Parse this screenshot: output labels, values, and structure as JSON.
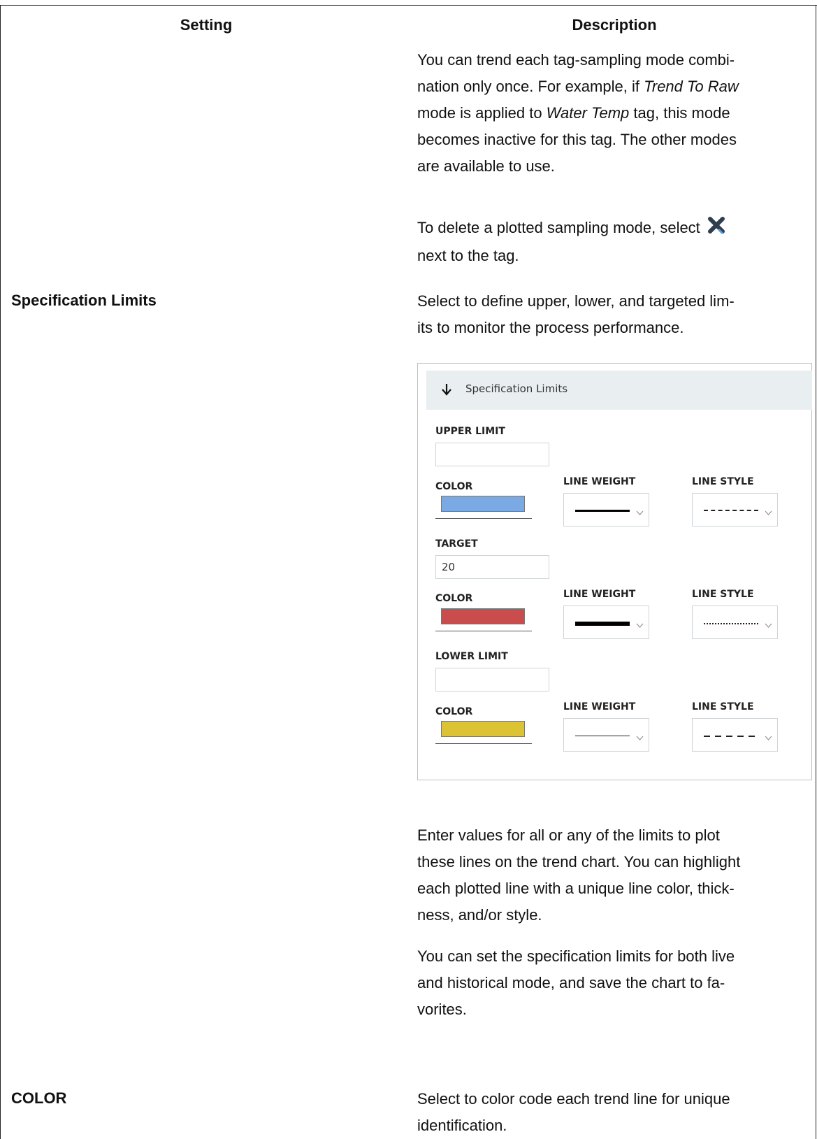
{
  "table": {
    "header_setting": "Setting",
    "header_description": "Description"
  },
  "row1": {
    "p1": {
      "t1": "You can trend each tag-sampling mode combi-",
      "t2": "nation only once. For example, if ",
      "t2_em": "Trend To Raw",
      "t3_em": "",
      "t3": "mode is applied to ",
      "t3_em2": "Water Temp",
      "t3_rest": " tag, this mode",
      "t4": "becomes inactive for this tag. The other modes",
      "t5": "are available to use."
    },
    "p2": {
      "t1": "To delete a plotted sampling mode, select",
      "t2": "next to the tag."
    }
  },
  "row2": {
    "setting": "Specification Limits",
    "intro_l1": "Select to define upper, lower, and targeted lim-",
    "intro_l2": "its to monitor the process performance.",
    "panel": {
      "title": "Specification Limits",
      "upper_label": "UPPER LIMIT",
      "upper_value": "",
      "target_label": "TARGET",
      "target_value": "20",
      "lower_label": "LOWER LIMIT",
      "lower_value": "",
      "color_label": "COLOR",
      "weight_label": "LINE WEIGHT",
      "style_label": "LINE STYLE",
      "colors": {
        "upper": "#7aa9e3",
        "target": "#c94d4d",
        "lower": "#dcc333"
      }
    },
    "p_after_1": {
      "l1": "Enter values for all or any of the limits to plot",
      "l2": "these lines on the trend chart. You can highlight",
      "l3": "each plotted line with a unique line color, thick-",
      "l4": "ness, and/or style."
    },
    "p_after_2": {
      "l1": "You can set the specification limits for both live",
      "l2": "and historical mode, and save the chart to fa-",
      "l3": "vorites."
    }
  },
  "row3": {
    "setting": "COLOR",
    "l1": "Select to color code each trend line for unique",
    "l2": "identification."
  }
}
